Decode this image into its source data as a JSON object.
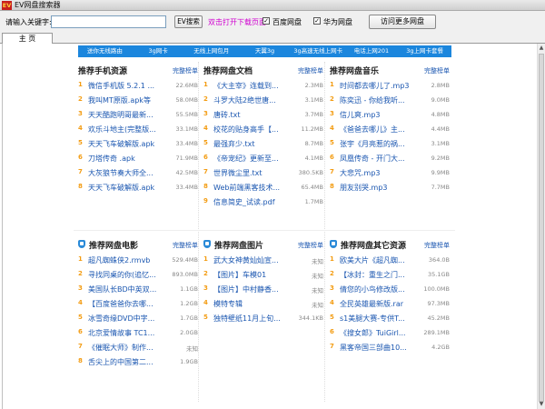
{
  "app": {
    "title": "EV网盘搜索器",
    "logo_text": "EV"
  },
  "toolbar": {
    "keyword_label": "请输入关键字:",
    "keyword_value": "",
    "search_button": "EV搜索",
    "open_hint": "双击打开下载页面",
    "baidu_checked": "✓",
    "baidu_label": "百度网盘",
    "huawei_checked": "✓",
    "huawei_label": "华为网盘",
    "visit_button": "访问更多网盘"
  },
  "tabs": {
    "home": "主 页"
  },
  "navbar": [
    "送你无线路由",
    "3g网卡",
    "无线上网包月",
    "天翼3g",
    "3g高速无线上网卡",
    "电话上网201",
    "3g上网卡套餐"
  ],
  "panels": [
    {
      "title": "推荐手机资源",
      "more": "完整榜单",
      "items": [
        {
          "num": "1",
          "name": "微信手机版 5.2.1 ...",
          "size": "22.6MB"
        },
        {
          "num": "2",
          "name": "我叫MT原版.apk等",
          "size": "58.0MB"
        },
        {
          "num": "3",
          "name": "天天酷跑明哥最新...",
          "size": "55.5MB"
        },
        {
          "num": "4",
          "name": "欢乐斗地主(完整版...",
          "size": "33.1MB"
        },
        {
          "num": "5",
          "name": "天天飞车破解版.apk",
          "size": "33.4MB"
        },
        {
          "num": "6",
          "name": "刀塔传奇 .apk",
          "size": "71.9MB"
        },
        {
          "num": "7",
          "name": "大灰狼节奏大师全...",
          "size": "42.5MB"
        },
        {
          "num": "8",
          "name": "天天飞车破解版.apk",
          "size": "33.4MB"
        }
      ]
    },
    {
      "title": "推荐网盘文档",
      "more": "完整榜单",
      "items": [
        {
          "num": "1",
          "name": "《大主宰》连载到...",
          "size": "2.3MB"
        },
        {
          "num": "2",
          "name": "斗罗大陆2绝世唐...",
          "size": "3.1MB"
        },
        {
          "num": "3",
          "name": "唐砖.txt",
          "size": "3.7MB"
        },
        {
          "num": "4",
          "name": "校花的贴身高手【...",
          "size": "11.2MB"
        },
        {
          "num": "5",
          "name": "最强弃少.txt",
          "size": "8.7MB"
        },
        {
          "num": "6",
          "name": "《帝宠纪》更新至...",
          "size": "4.1MB"
        },
        {
          "num": "7",
          "name": "世界微尘里.txt",
          "size": "380.5KB"
        },
        {
          "num": "8",
          "name": "Web前端黑客技术...",
          "size": "65.4MB"
        },
        {
          "num": "9",
          "name": "信息简史_试读.pdf",
          "size": "1.7MB"
        }
      ]
    },
    {
      "title": "推荐网盘音乐",
      "more": "完整榜单",
      "items": [
        {
          "num": "1",
          "name": "时间都去哪儿了.mp3",
          "size": "2.8MB"
        },
        {
          "num": "2",
          "name": "陈奕迅 - 你给我听...",
          "size": "9.0MB"
        },
        {
          "num": "3",
          "name": "信儿爽.mp3",
          "size": "4.8MB"
        },
        {
          "num": "4",
          "name": "《爸爸去哪儿》主...",
          "size": "4.4MB"
        },
        {
          "num": "5",
          "name": "张宇《月亮惹的祸...",
          "size": "3.1MB"
        },
        {
          "num": "6",
          "name": "凤凰传奇 - 开门大...",
          "size": "9.2MB"
        },
        {
          "num": "7",
          "name": "大悲咒.mp3",
          "size": "9.9MB"
        },
        {
          "num": "8",
          "name": "朋友别哭.mp3",
          "size": "7.7MB"
        }
      ]
    },
    {
      "title": "推荐网盘电影",
      "more": "完整榜单",
      "items": [
        {
          "num": "1",
          "name": "超凡蜘蛛侠2.rmvb",
          "size": "529.4MB"
        },
        {
          "num": "2",
          "name": "寻找同桌的你(追忆...",
          "size": "893.0MB"
        },
        {
          "num": "3",
          "name": "美国队长BD中英双...",
          "size": "1.1GB"
        },
        {
          "num": "4",
          "name": "【百度爸爸你去哪...",
          "size": "1.2GB"
        },
        {
          "num": "5",
          "name": "冰雪奇缘DVD中字...",
          "size": "1.7GB"
        },
        {
          "num": "6",
          "name": "北京爱情故事 TC1...",
          "size": "2.0GB"
        },
        {
          "num": "7",
          "name": "《催眠大师》制作...",
          "size": "未知"
        },
        {
          "num": "8",
          "name": "舌尖上的中国第二...",
          "size": "1.9GB"
        }
      ]
    },
    {
      "title": "推荐网盘图片",
      "more": "完整榜单",
      "items": [
        {
          "num": "1",
          "name": "武大女神黄灿灿宣...",
          "size": "未知"
        },
        {
          "num": "2",
          "name": "【图片】车模01",
          "size": "未知"
        },
        {
          "num": "3",
          "name": "【图片】中村静香...",
          "size": "未知"
        },
        {
          "num": "4",
          "name": "模特专辑",
          "size": "未知"
        },
        {
          "num": "5",
          "name": "独特壁纸11月上旬...",
          "size": "344.1KB"
        }
      ]
    },
    {
      "title": "推荐网盘其它资源",
      "more": "完整榜单",
      "items": [
        {
          "num": "1",
          "name": "欧美大片《超凡蜘...",
          "size": "364.0B"
        },
        {
          "num": "2",
          "name": "【冰封：重生之门...",
          "size": "35.1GB"
        },
        {
          "num": "3",
          "name": "倩您的小鸟修改版...",
          "size": "100.0MB"
        },
        {
          "num": "4",
          "name": "全民英雄最新版.rar",
          "size": "97.3MB"
        },
        {
          "num": "5",
          "name": "s1美腿大赛-专供T...",
          "size": "45.2MB"
        },
        {
          "num": "6",
          "name": "《搜女郎》TuiGirl...",
          "size": "289.1MB"
        },
        {
          "num": "7",
          "name": "黑客帝国三部曲10...",
          "size": "4.2GB"
        }
      ]
    }
  ]
}
